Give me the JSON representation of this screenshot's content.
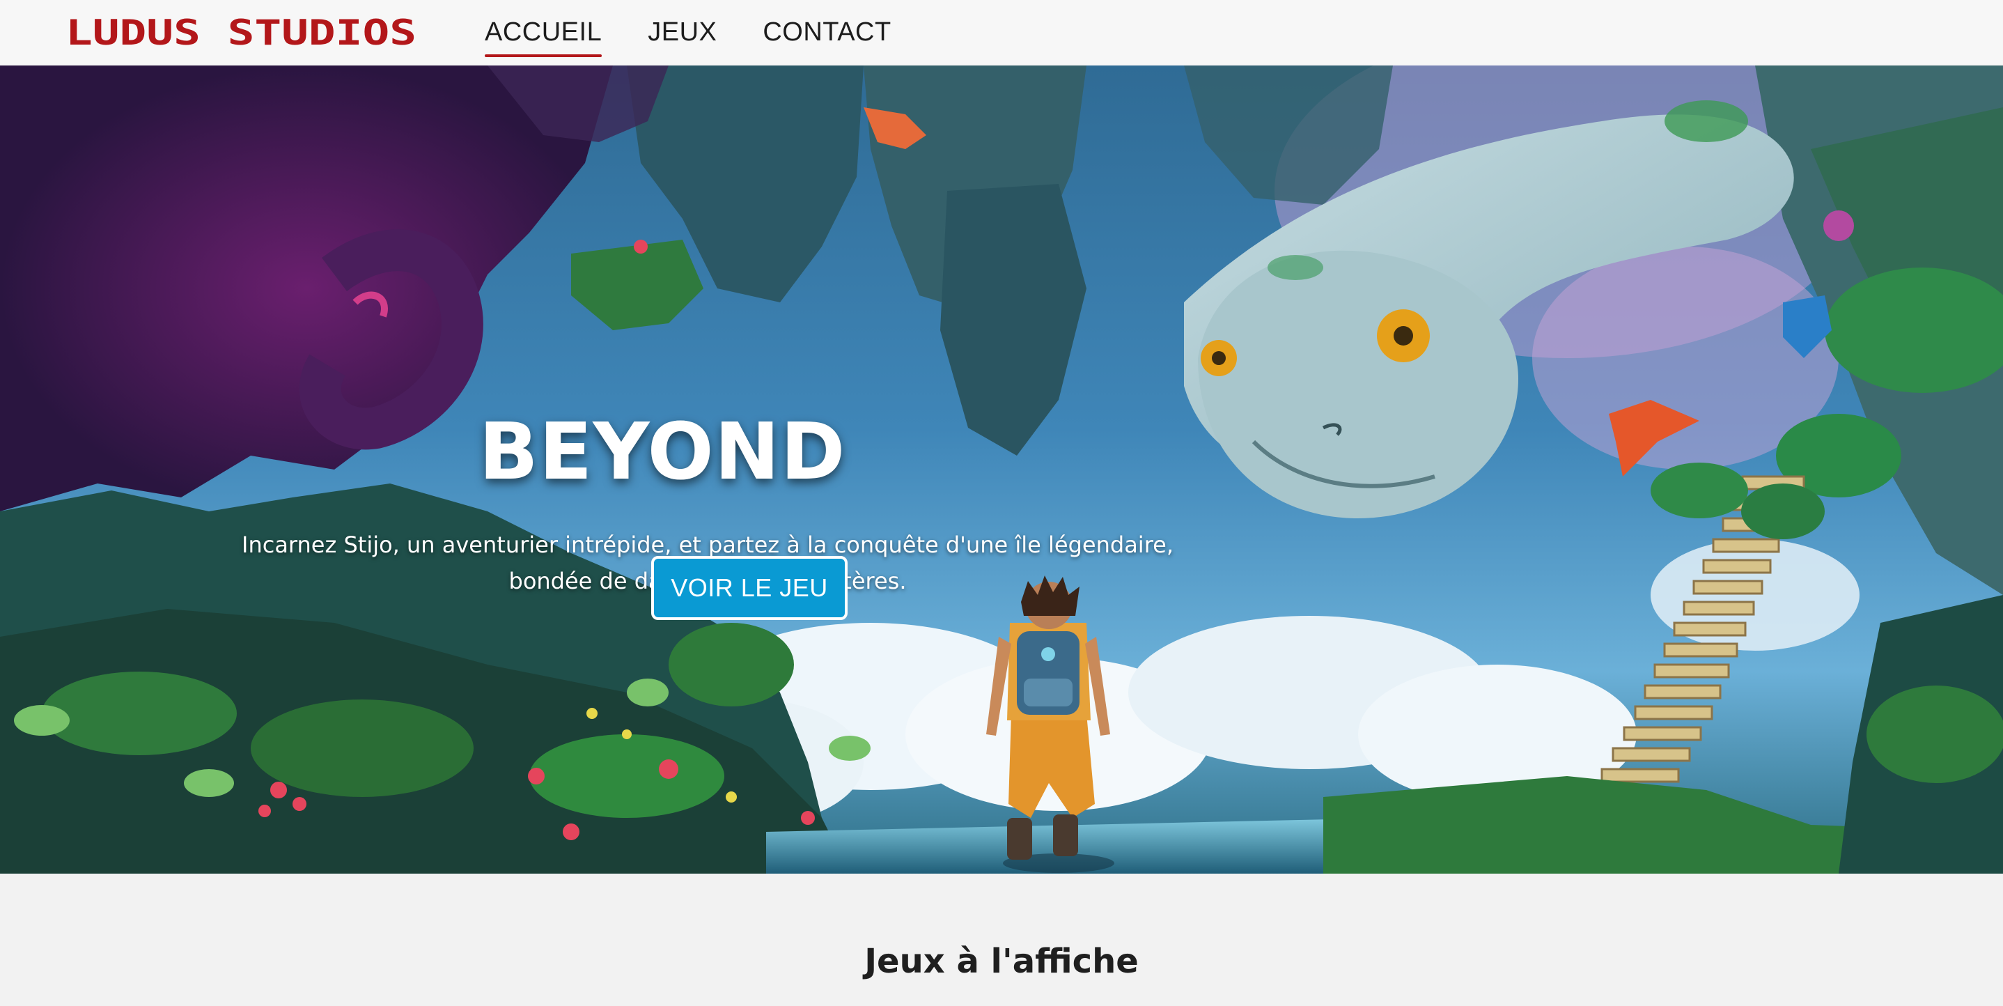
{
  "brand": {
    "logo_text": "LUDUS STUDIOS",
    "logo_color": "#b3171a"
  },
  "nav": {
    "items": [
      {
        "label": "ACCUEIL",
        "active": true
      },
      {
        "label": "JEUX",
        "active": false
      },
      {
        "label": "CONTACT",
        "active": false
      }
    ]
  },
  "hero": {
    "title": "BEYOND",
    "description_line1": "Incarnez Stijo, un aventurier intrépide, et partez à la conquête d'une île légendaire,",
    "description_line2": "bondée de dangers et de mystères.",
    "cta_label": "VOIR LE JEU",
    "cta_color": "#0a9ad3"
  },
  "featured": {
    "title": "Jeux à l'affiche"
  }
}
